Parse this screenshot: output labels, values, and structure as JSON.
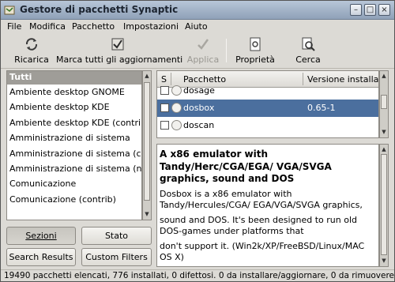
{
  "window": {
    "title": "Gestore di pacchetti Synaptic"
  },
  "titlebar_buttons": [
    "minimize-icon",
    "maximize-icon",
    "close-icon"
  ],
  "menu": {
    "file": "File",
    "modifica": "Modifica",
    "pacchetto": "Pacchetto",
    "impostazioni": "Impostazioni",
    "aiuto": "Aiuto"
  },
  "toolbar": {
    "ricarica": "Ricarica",
    "marca": "Marca tutti gli aggiornamenti",
    "applica": "Applica",
    "proprieta": "Proprietà",
    "cerca": "Cerca"
  },
  "categories": {
    "selected": "Tutti",
    "items": [
      "Ambiente desktop GNOME",
      "Ambiente desktop KDE",
      "Ambiente desktop KDE (contrib",
      "Amministrazione di sistema",
      "Amministrazione di sistema (co",
      "Amministrazione di sistema (no",
      "Comunicazione",
      "Comunicazione (contrib)"
    ]
  },
  "filters": {
    "sezioni": "Sezioni",
    "stato": "Stato",
    "search_results": "Search Results",
    "custom_filters": "Custom Filters"
  },
  "packages": {
    "columns": {
      "s": "S",
      "pacchetto": "Pacchetto",
      "versione": "Versione installata"
    },
    "rows": [
      {
        "name": "dosage",
        "version": ""
      },
      {
        "name": "dosbox",
        "version": "0.65-1"
      },
      {
        "name": "doscan",
        "version": ""
      }
    ]
  },
  "description": {
    "title": "A x86 emulator with Tandy/Herc/CGA/EGA/ VGA/SVGA graphics, sound and DOS",
    "p1": "Dosbox is a x86 emulator with Tandy/Hercules/CGA/ EGA/VGA/SVGA graphics,",
    "p2": "sound and DOS. It's been designed to run old DOS-games under platforms that",
    "p3": "don't support it. (Win2k/XP/FreeBSD/Linux/MAC OS X)"
  },
  "status": "19490 pacchetti elencati, 776 installati, 0 difettosi. 0 da installare/aggiornare, 0 da rimuovere",
  "colors": {
    "selection": "#4b6f9e",
    "category_selected": "#9f9d98",
    "window_bg": "#dcdad5"
  }
}
